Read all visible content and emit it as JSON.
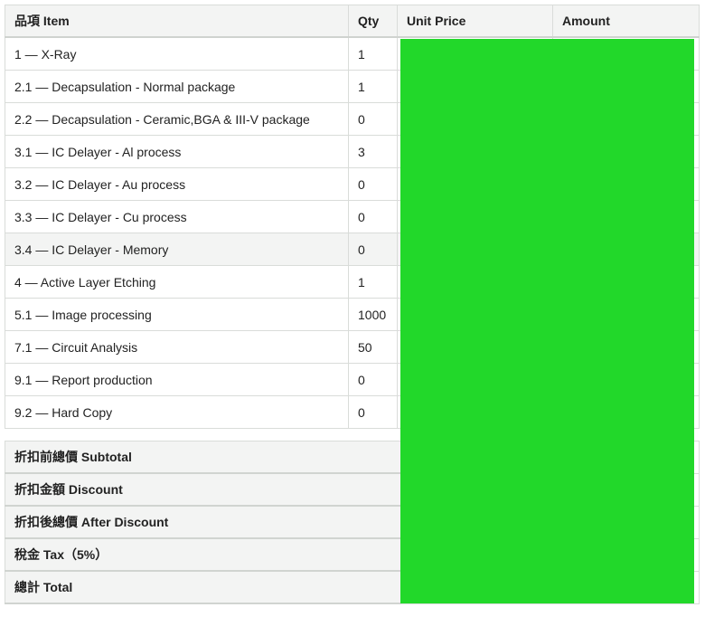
{
  "table": {
    "headers": {
      "item": "品項 Item",
      "qty": "Qty",
      "unit_price": "Unit Price",
      "amount": "Amount"
    },
    "rows": [
      {
        "item": "1 — X-Ray",
        "qty": "1"
      },
      {
        "item": "2.1 — Decapsulation - Normal package",
        "qty": "1"
      },
      {
        "item": "2.2 — Decapsulation - Ceramic,BGA & III-V package",
        "qty": "0"
      },
      {
        "item": "3.1 — IC Delayer - Al process",
        "qty": "3"
      },
      {
        "item": "3.2 — IC Delayer - Au process",
        "qty": "0"
      },
      {
        "item": "3.3 — IC Delayer - Cu process",
        "qty": "0"
      },
      {
        "item": "3.4 — IC Delayer - Memory",
        "qty": "0"
      },
      {
        "item": "4 — Active Layer Etching",
        "qty": "1"
      },
      {
        "item": "5.1 — Image processing",
        "qty": "1000"
      },
      {
        "item": "7.1 — Circuit Analysis",
        "qty": "50"
      },
      {
        "item": "9.1 — Report production",
        "qty": "0"
      },
      {
        "item": "9.2 — Hard Copy",
        "qty": "0"
      }
    ]
  },
  "summary": {
    "subtotal": "折扣前總價 Subtotal",
    "discount": "折扣金額 Discount",
    "after_discount": "折扣後總價 After Discount",
    "tax": "稅金 Tax（5%）",
    "total": "總計 Total"
  },
  "colors": {
    "redaction": "#22d82a",
    "header_bg": "#f3f4f3",
    "border": "#d9dcd9"
  }
}
